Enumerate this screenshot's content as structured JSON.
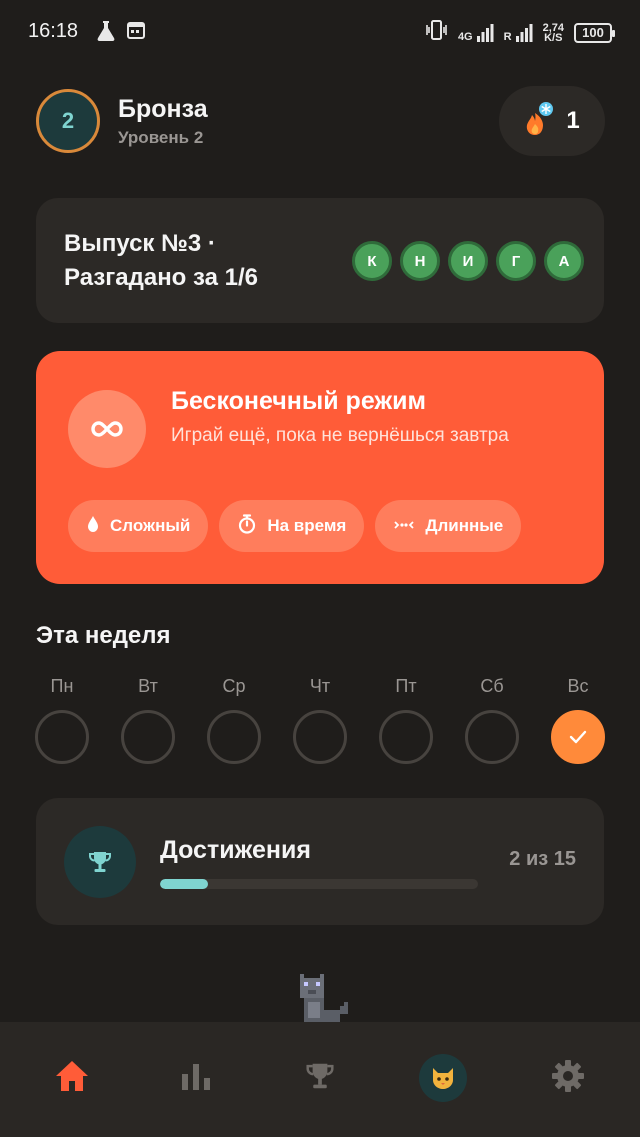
{
  "status_bar": {
    "time": "16:18",
    "network_4g": "4G",
    "roaming": "R",
    "speed_value": "2,74",
    "speed_unit": "K/S",
    "battery": "100"
  },
  "header": {
    "level_number": "2",
    "rank_title": "Бронза",
    "rank_subtitle": "Уровень 2",
    "streak_count": "1"
  },
  "issue": {
    "line1": "Выпуск №3 ·",
    "line2": "Разгадано за 1/6",
    "letters": [
      "К",
      "Н",
      "И",
      "Г",
      "А"
    ],
    "letter_color": "#4aa15a"
  },
  "endless": {
    "title": "Бесконечный режим",
    "description": "Играй ещё, пока не вернёшься завтра",
    "modes": [
      {
        "label": "Сложный",
        "icon": "drop-icon"
      },
      {
        "label": "На время",
        "icon": "stopwatch-icon"
      },
      {
        "label": "Длинные",
        "icon": "dots-icon"
      }
    ],
    "color": "#ff5c38"
  },
  "week": {
    "title": "Эта неделя",
    "days": [
      {
        "label": "Пн",
        "done": false
      },
      {
        "label": "Вт",
        "done": false
      },
      {
        "label": "Ср",
        "done": false
      },
      {
        "label": "Чт",
        "done": false
      },
      {
        "label": "Пт",
        "done": false
      },
      {
        "label": "Сб",
        "done": false
      },
      {
        "label": "Вс",
        "done": true
      }
    ],
    "done_color": "#ff8a3a"
  },
  "achievements": {
    "title": "Достижения",
    "count_text": "2 из 15",
    "progress": 0.15,
    "accent": "#7fd4d0"
  },
  "nav": {
    "items": [
      {
        "name": "home",
        "icon": "home-icon",
        "active": true
      },
      {
        "name": "stats",
        "icon": "bar-chart-icon",
        "active": false
      },
      {
        "name": "trophies",
        "icon": "trophy-icon",
        "active": false
      },
      {
        "name": "pet",
        "icon": "cat-icon",
        "active": false
      },
      {
        "name": "settings",
        "icon": "gear-icon",
        "active": false
      }
    ],
    "active_color": "#ff5c38"
  }
}
